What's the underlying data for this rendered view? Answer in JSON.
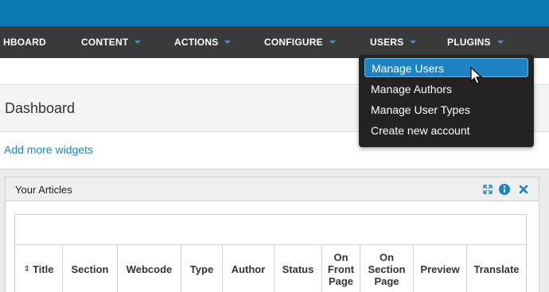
{
  "nav": {
    "items": [
      {
        "label": "HBOARD",
        "caret": false
      },
      {
        "label": "CONTENT",
        "caret": true
      },
      {
        "label": "ACTIONS",
        "caret": true
      },
      {
        "label": "CONFIGURE",
        "caret": true
      },
      {
        "label": "USERS",
        "caret": true
      },
      {
        "label": "PLUGINS",
        "caret": true
      }
    ]
  },
  "page": {
    "title": "Dashboard",
    "add_widgets": "Add more widgets"
  },
  "widget": {
    "title": "Your Articles",
    "icons": [
      "expand-icon",
      "info-icon",
      "close-icon"
    ],
    "columns": [
      "Title",
      "Section",
      "Webcode",
      "Type",
      "Author",
      "Status",
      "On Front Page",
      "On Section Page",
      "Preview",
      "Translate"
    ]
  },
  "users_menu": {
    "items": [
      "Manage Users",
      "Manage Authors",
      "Manage User Types",
      "Create new account"
    ],
    "highlighted": "Manage Users"
  },
  "colors": {
    "topbar": "#0b7ab3",
    "navbar": "#3a3a3a",
    "accent": "#2a9fd6",
    "link": "#1a85c2",
    "menu_bg": "#232323",
    "menu_highlight": "#1c84c4"
  }
}
